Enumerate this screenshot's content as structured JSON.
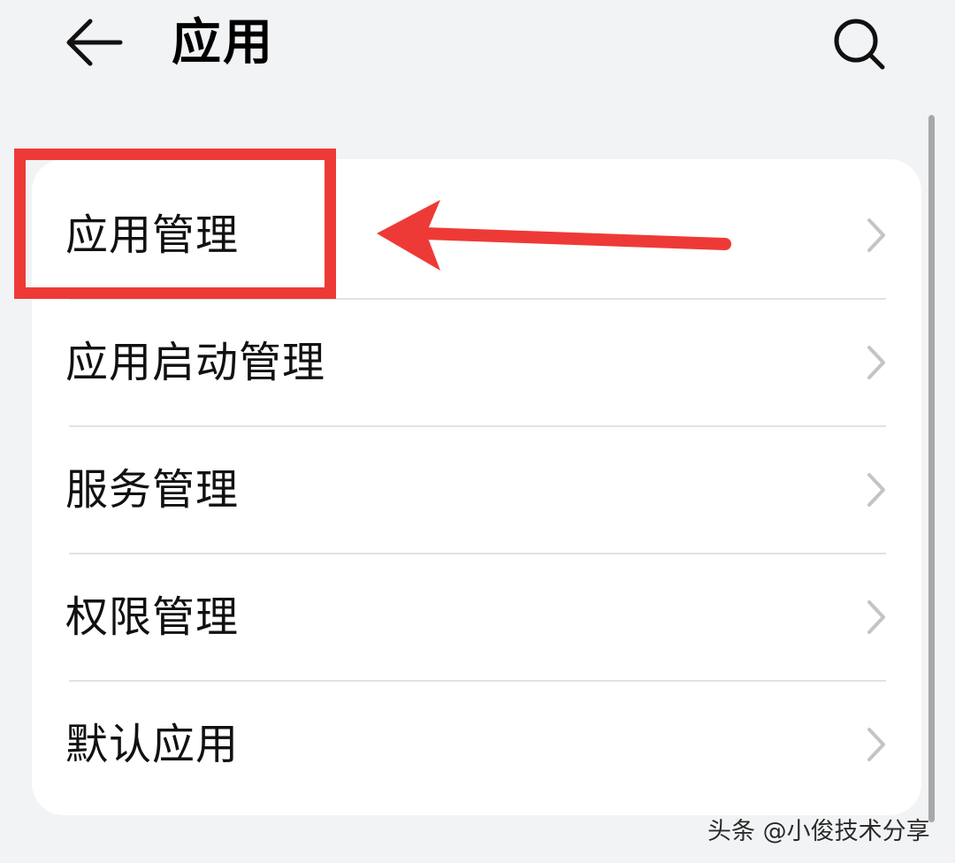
{
  "header": {
    "back_icon": "arrow-left-icon",
    "title": "应用",
    "search_icon": "search-icon"
  },
  "menu": {
    "items": [
      {
        "label": "应用管理",
        "icon": "chevron-right-icon"
      },
      {
        "label": "应用启动管理",
        "icon": "chevron-right-icon"
      },
      {
        "label": "服务管理",
        "icon": "chevron-right-icon"
      },
      {
        "label": "权限管理",
        "icon": "chevron-right-icon"
      },
      {
        "label": "默认应用",
        "icon": "chevron-right-icon"
      }
    ]
  },
  "annotation": {
    "highlight_color": "#ee3a36",
    "arrow_icon": "red-arrow-left-icon"
  },
  "watermark": "头条 @小俊技术分享",
  "colors": {
    "background": "#f1f3f5",
    "card": "#ffffff",
    "chevron": "#c4c4c4",
    "divider": "#e2e2e2"
  }
}
